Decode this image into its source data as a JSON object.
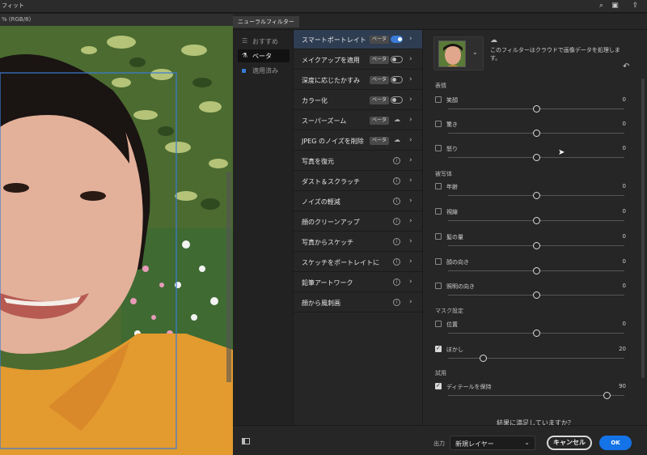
{
  "topbar": {
    "menu": "フィット",
    "icons": [
      "search-icon",
      "layout-icon",
      "share-icon"
    ]
  },
  "document": {
    "tab_text": "% (RGB/8)"
  },
  "panel": {
    "title": "ニューラルフィルター"
  },
  "categories": [
    {
      "label": "おすすめ",
      "icon": "sliders-icon",
      "active": false
    },
    {
      "label": "ベータ",
      "icon": "flask-icon",
      "active": true
    },
    {
      "label": "適用済み",
      "icon": "square-icon",
      "active": false
    }
  ],
  "filters": [
    {
      "label": "スマートポートレイト",
      "beta": "ベータ",
      "control": "toggle-on",
      "selected": true
    },
    {
      "label": "メイクアップを適用",
      "beta": "ベータ",
      "control": "toggle-off",
      "selected": false
    },
    {
      "label": "深度に応じたかすみ",
      "beta": "ベータ",
      "control": "toggle-off",
      "selected": false
    },
    {
      "label": "カラー化",
      "beta": "ベータ",
      "control": "toggle-off",
      "selected": false
    },
    {
      "label": "スーパーズーム",
      "beta": "ベータ",
      "control": "cloud",
      "selected": false
    },
    {
      "label": "JPEG のノイズを削除",
      "beta": "ベータ",
      "control": "cloud",
      "selected": false
    },
    {
      "label": "写真を復元",
      "beta": "",
      "control": "info",
      "selected": false
    },
    {
      "label": "ダスト＆スクラッチ",
      "beta": "",
      "control": "info",
      "selected": false
    },
    {
      "label": "ノイズの軽減",
      "beta": "",
      "control": "info",
      "selected": false
    },
    {
      "label": "顔のクリーンアップ",
      "beta": "",
      "control": "info",
      "selected": false
    },
    {
      "label": "写真からスケッチ",
      "beta": "",
      "control": "info",
      "selected": false
    },
    {
      "label": "スケッチをポートレイトに",
      "beta": "",
      "control": "info",
      "selected": false
    },
    {
      "label": "鉛筆アートワーク",
      "beta": "",
      "control": "info",
      "selected": false
    },
    {
      "label": "顔から風刺画",
      "beta": "",
      "control": "info",
      "selected": false
    }
  ],
  "settings": {
    "cloud_notice": "このフィルターはクラウドで画像データを処理します。",
    "sections": [
      {
        "label": "表情",
        "rows": [
          {
            "label": "笑顔",
            "value": "0",
            "checked": false,
            "level": 0.5
          },
          {
            "label": "驚き",
            "value": "0",
            "checked": false,
            "level": 0.5
          },
          {
            "label": "怒り",
            "value": "0",
            "checked": false,
            "level": 0.5
          }
        ]
      },
      {
        "label": "被写体",
        "rows": [
          {
            "label": "年齢",
            "value": "0",
            "checked": false,
            "level": 0.5
          },
          {
            "label": "視線",
            "value": "0",
            "checked": false,
            "level": 0.5
          },
          {
            "label": "髪の量",
            "value": "0",
            "checked": false,
            "level": 0.5
          },
          {
            "label": "顔の向き",
            "value": "0",
            "checked": false,
            "level": 0.5
          },
          {
            "label": "照明の向き",
            "value": "0",
            "checked": false,
            "level": 0.5
          }
        ]
      },
      {
        "label": "マスク設定",
        "rows": [
          {
            "label": "位置",
            "value": "0",
            "checked": false,
            "level": 0.5
          },
          {
            "label": "ぼかし",
            "value": "20",
            "checked": true,
            "level": 0.2
          }
        ]
      },
      {
        "label": "試用",
        "rows": [
          {
            "label": "ディテールを保持",
            "value": "90",
            "checked": true,
            "level": 0.9
          }
        ]
      }
    ],
    "satisfied_prompt": "結果に満足していますか？"
  },
  "footer": {
    "output_label": "出力",
    "output_value": "新規レイヤー",
    "cancel_label": "キャンセル",
    "ok_label": "OK"
  },
  "colors": {
    "accent": "#1473e6",
    "selected_row": "#2f3d52",
    "panel_bg": "#262626"
  }
}
